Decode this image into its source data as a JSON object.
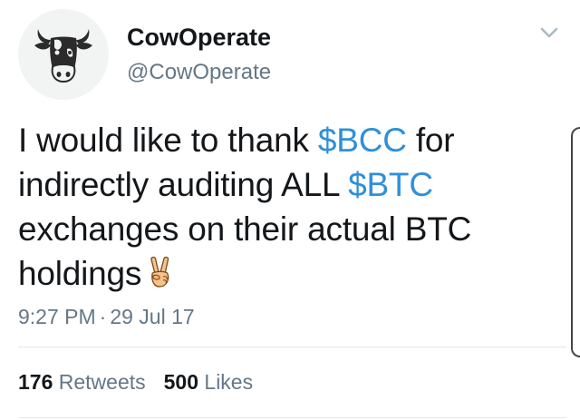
{
  "author": {
    "display_name": "CowOperate",
    "handle": "@CowOperate",
    "avatar_icon": "cow-head-icon"
  },
  "tweet": {
    "segments": [
      {
        "text": "I would like to thank ",
        "type": "text"
      },
      {
        "text": "$BCC",
        "type": "cashtag"
      },
      {
        "text": " for indirectly auditing ALL ",
        "type": "text"
      },
      {
        "text": "$BTC",
        "type": "cashtag"
      },
      {
        "text": " exchanges on their actual BTC holdings",
        "type": "text"
      }
    ],
    "emoji": "victory-hand-emoji",
    "time": "9:27 PM",
    "separator": "·",
    "date": "29 Jul 17"
  },
  "stats": {
    "retweets_count": "176",
    "retweets_label": "Retweets",
    "likes_count": "500",
    "likes_label": "Likes"
  },
  "colors": {
    "cashtag": "#2f90d9",
    "secondary_text": "#657786",
    "primary_text": "#14171a",
    "divider": "#e1e8ed"
  },
  "icons": {
    "menu": "chevron-down-icon"
  }
}
